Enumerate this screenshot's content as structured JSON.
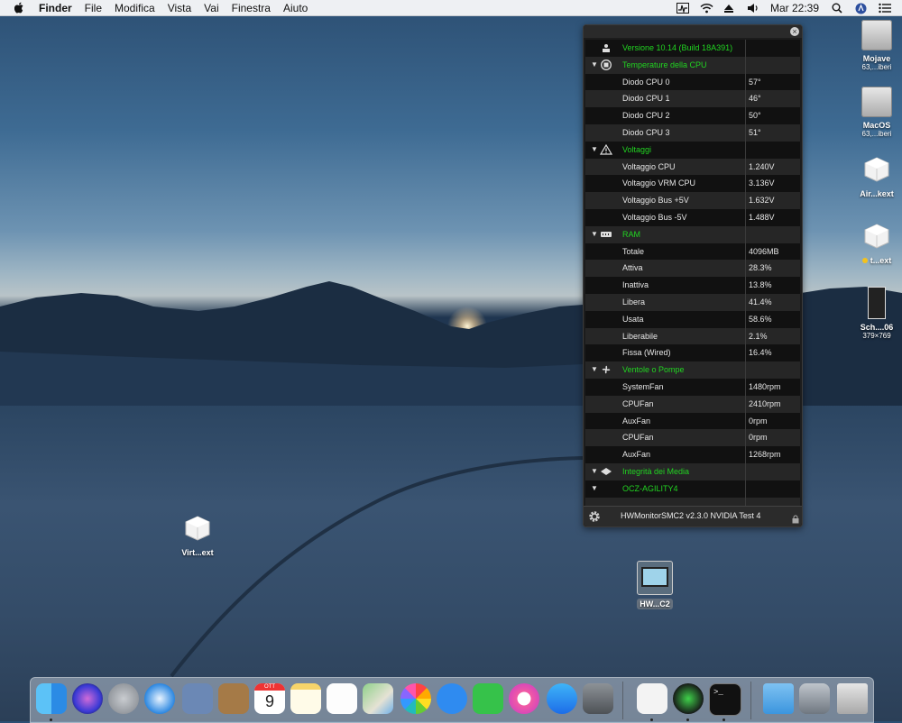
{
  "menubar": {
    "app": "Finder",
    "menus": [
      "File",
      "Modifica",
      "Vista",
      "Vai",
      "Finestra",
      "Aiuto"
    ],
    "clock": "Mar 22:39"
  },
  "panel": {
    "rows": [
      {
        "kind": "header",
        "tri": "",
        "icon": "apple-boot-icon",
        "label": "Versione 10.14 (Build 18A391)",
        "value": ""
      },
      {
        "kind": "header",
        "tri": "▼",
        "icon": "cpu-icon",
        "label": "Temperature della CPU",
        "value": ""
      },
      {
        "kind": "item",
        "label": "Diodo CPU 0",
        "value": "57°"
      },
      {
        "kind": "item",
        "label": "Diodo CPU 1",
        "value": "46°"
      },
      {
        "kind": "item",
        "label": "Diodo CPU 2",
        "value": "50°"
      },
      {
        "kind": "item",
        "label": "Diodo CPU 3",
        "value": "51°"
      },
      {
        "kind": "header",
        "tri": "▼",
        "icon": "warning-icon",
        "label": "Voltaggi",
        "value": ""
      },
      {
        "kind": "item",
        "label": "Voltaggio CPU",
        "value": "1.240V"
      },
      {
        "kind": "item",
        "label": "Voltaggio VRM CPU",
        "value": "3.136V"
      },
      {
        "kind": "item",
        "label": "Voltaggio Bus +5V",
        "value": "1.632V"
      },
      {
        "kind": "item",
        "label": "Voltaggio Bus -5V",
        "value": "1.488V"
      },
      {
        "kind": "header",
        "tri": "▼",
        "icon": "ram-icon",
        "label": "RAM",
        "value": ""
      },
      {
        "kind": "item",
        "label": "Totale",
        "value": "4096MB"
      },
      {
        "kind": "item",
        "label": "Attiva",
        "value": "28.3%"
      },
      {
        "kind": "item",
        "label": "Inattiva",
        "value": "13.8%"
      },
      {
        "kind": "item",
        "label": "Libera",
        "value": "41.4%"
      },
      {
        "kind": "item",
        "label": "Usata",
        "value": "58.6%"
      },
      {
        "kind": "item",
        "label": "Liberabile",
        "value": "2.1%"
      },
      {
        "kind": "item",
        "label": "Fissa (Wired)",
        "value": "16.4%"
      },
      {
        "kind": "header",
        "tri": "▼",
        "icon": "fan-icon",
        "label": "Ventole o Pompe",
        "value": ""
      },
      {
        "kind": "item",
        "label": "SystemFan",
        "value": "1480rpm"
      },
      {
        "kind": "item",
        "label": "CPUFan",
        "value": "2410rpm"
      },
      {
        "kind": "item",
        "label": "AuxFan",
        "value": "0rpm"
      },
      {
        "kind": "item",
        "label": "CPUFan",
        "value": "0rpm"
      },
      {
        "kind": "item",
        "label": "AuxFan",
        "value": "1268rpm"
      },
      {
        "kind": "header",
        "tri": "▼",
        "icon": "media-icon",
        "label": "Integrità dei Media",
        "value": ""
      },
      {
        "kind": "header",
        "tri": "▼",
        "icon": "",
        "label": "OCZ-AGILITY4",
        "value": ""
      },
      {
        "kind": "item",
        "label": "",
        "value": ""
      }
    ],
    "footer": "HWMonitorSMC2 v2.3.0 NVIDIA Test 4"
  },
  "desktop": {
    "mojave": {
      "name": "Mojave",
      "sub": "63,...iberi"
    },
    "macos": {
      "name": "MacOS",
      "sub": "63,...iberi"
    },
    "airkext": {
      "name": "Air...kext"
    },
    "tkext": {
      "name": "t...ext"
    },
    "screenshot": {
      "name": "Sch....06",
      "sub": "379×769"
    },
    "virtkext": {
      "name": "Virt...ext"
    },
    "hwapp": {
      "name": "HW...C2"
    }
  },
  "calendar": {
    "month": "OTT",
    "day": "9"
  }
}
